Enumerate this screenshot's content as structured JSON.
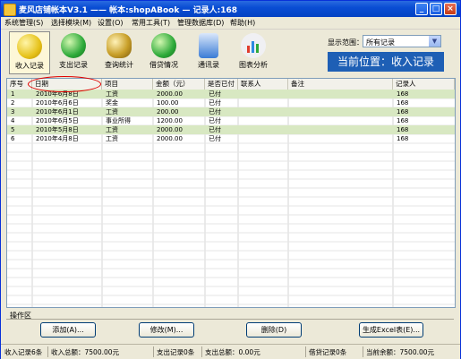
{
  "window": {
    "title": "麦风店铺帐本V3.1 —— 帐本:shopABook — 记录人:168"
  },
  "menu": [
    "系统管理(S)",
    "选择模块(M)",
    "设置(O)",
    "常用工具(T)",
    "管理数据库(D)",
    "帮助(H)"
  ],
  "toolbar": [
    {
      "label": "收入记录",
      "icon": "yen-income-icon",
      "color": "#e6c21a"
    },
    {
      "label": "支出记录",
      "icon": "yen-expense-icon",
      "color": "#2eaa3a"
    },
    {
      "label": "查询统计",
      "icon": "magnifier-icon",
      "color": "#c9a02a"
    },
    {
      "label": "借贷情况",
      "icon": "loan-icon",
      "color": "#2eaa3a"
    },
    {
      "label": "通讯录",
      "icon": "address-book-icon",
      "color": "#3a7bd5"
    },
    {
      "label": "图表分析",
      "icon": "bar-chart-icon",
      "color": "#cfd3dc"
    }
  ],
  "range": {
    "label": "显示范围：",
    "value": "所有记录"
  },
  "position_text": "当前位置：收入记录",
  "table": {
    "headers": [
      "序号",
      "日期",
      "项目",
      "金额（元）",
      "是否已付",
      "联系人",
      "备注",
      "记录人"
    ],
    "rows": [
      [
        "1",
        "2010年6月8日",
        "工资",
        "2000.00",
        "已付",
        "",
        "",
        "168"
      ],
      [
        "2",
        "2010年6月6日",
        "奖金",
        "100.00",
        "已付",
        "",
        "",
        "168"
      ],
      [
        "3",
        "2010年6月1日",
        "工资",
        "200.00",
        "已付",
        "",
        "",
        "168"
      ],
      [
        "4",
        "2010年6月5日",
        "事业所得",
        "1200.00",
        "已付",
        "",
        "",
        "168"
      ],
      [
        "5",
        "2010年5月8日",
        "工资",
        "2000.00",
        "已付",
        "",
        "",
        "168"
      ],
      [
        "6",
        "2010年4月8日",
        "工资",
        "2000.00",
        "已付",
        "",
        "",
        "168"
      ]
    ]
  },
  "ops": {
    "section_label": "操作区",
    "add": "添加(A)...",
    "modify": "修改(M)...",
    "delete": "删除(D)",
    "excel": "生成Excel表(E)..."
  },
  "status": {
    "income_count": "收入记录6条",
    "income_total": "收入总额：7500.00元",
    "expense_count": "支出记录0条",
    "expense_total": "支出总额：0.00元",
    "loan_count": "借贷记录0条",
    "balance": "当前余额：7500.00元"
  }
}
